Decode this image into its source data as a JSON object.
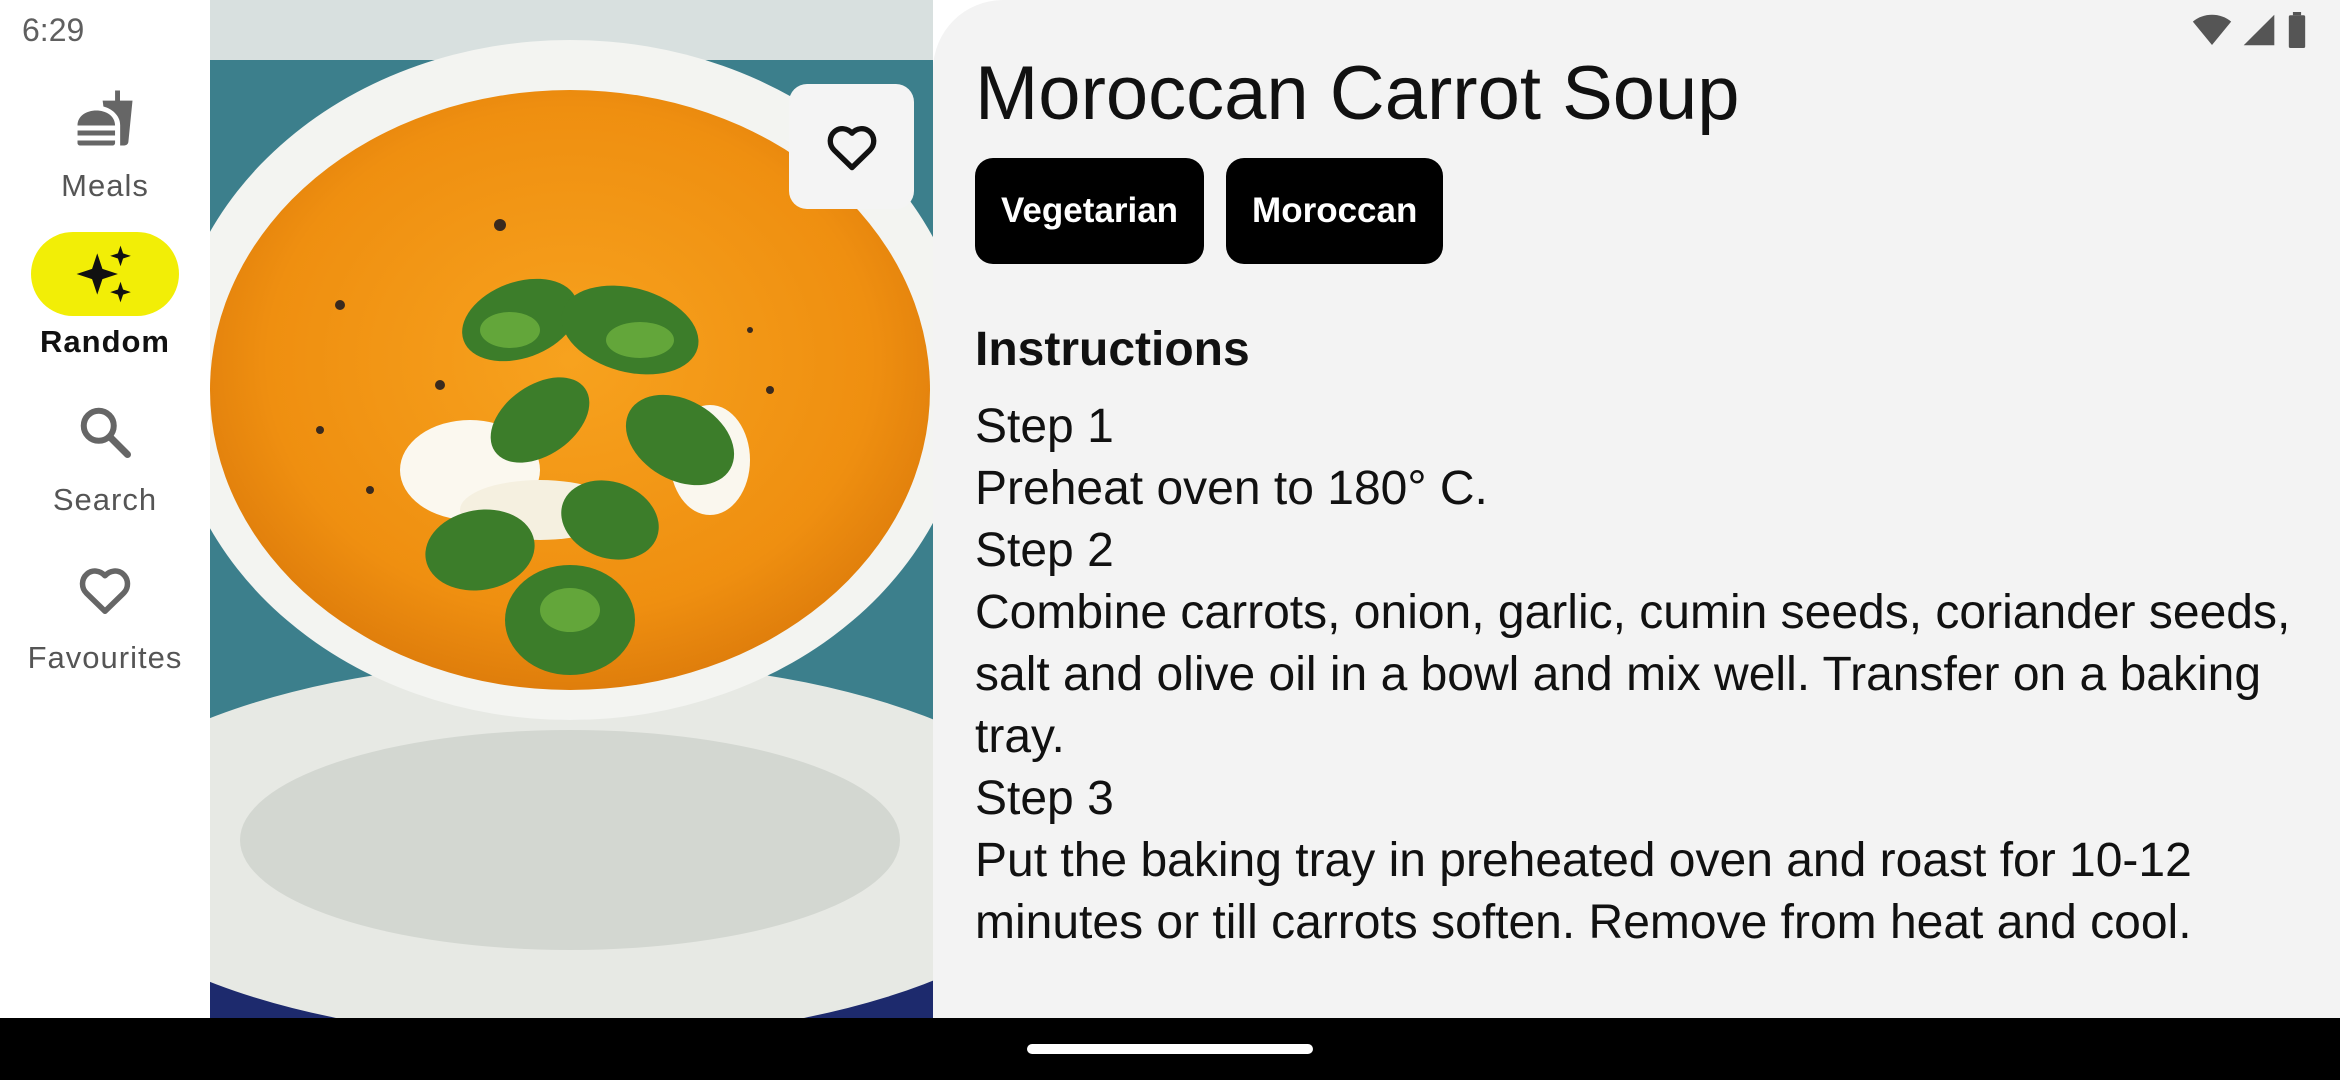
{
  "status_bar": {
    "time": "6:29"
  },
  "nav": {
    "items": [
      {
        "label": "Meals",
        "icon": "fastfood-icon",
        "active": false
      },
      {
        "label": "Random",
        "icon": "sparkles-icon",
        "active": true
      },
      {
        "label": "Search",
        "icon": "search-icon",
        "active": false
      },
      {
        "label": "Favourites",
        "icon": "heart-outline-icon",
        "active": false
      }
    ],
    "active_color": "#f2ee06"
  },
  "meal": {
    "title": "Moroccan Carrot Soup",
    "tags": [
      "Vegetarian",
      "Moroccan"
    ],
    "instructions_heading": "Instructions",
    "instructions": [
      "Step 1",
      "Preheat oven to 180° C.",
      "Step 2",
      "Combine carrots, onion, garlic, cumin seeds, coriander seeds, salt and olive oil in a bowl and mix well. Transfer on a baking tray.",
      "Step 3",
      "Put the baking tray in preheated oven and roast for 10-12 minutes or till carrots soften. Remove from heat and cool."
    ]
  },
  "favourite_button": {
    "icon": "heart-outline-icon",
    "favourited": false
  }
}
